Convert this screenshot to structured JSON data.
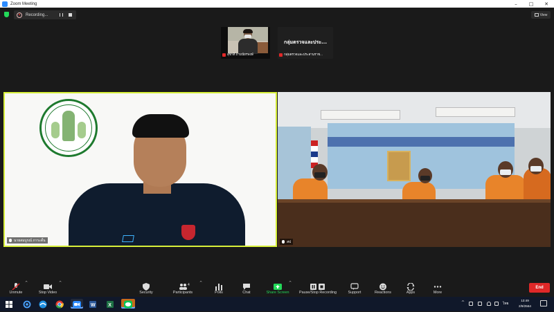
{
  "window": {
    "title": "Zoom Meeting",
    "controls": [
      "–",
      "□",
      "✕"
    ]
  },
  "recording": {
    "label": "Recording..."
  },
  "view_button": {
    "label": "View"
  },
  "thumbnails": [
    {
      "name": "สุชาติ ถามนัยรพงษ์",
      "type": "video",
      "mic_muted": true
    },
    {
      "name": "กลุ่มตรวจและประสานราช...",
      "display_name": "กลุ่มตรวจและประ...",
      "type": "name",
      "mic_muted": true
    }
  ],
  "tiles": [
    {
      "name": "นายสมบูรณ์ ภาระดั้น",
      "side": "left",
      "active_speaker": true
    },
    {
      "name": "สป",
      "side": "right",
      "active_speaker": false
    }
  ],
  "toolbar": {
    "unmute": "Unmute",
    "stop_video": "Stop Video",
    "security": "Security",
    "participants": "Participants",
    "participants_count": "4",
    "polls": "Polls",
    "chat": "Chat",
    "share_screen": "Share Screen",
    "pause_stop_recording": "Pause/Stop Recording",
    "support": "Support",
    "reactions": "Reactions",
    "apps": "Apps",
    "more": "More",
    "end": "End"
  },
  "taskbar": {
    "time": "13:49",
    "date": "2/9/2564",
    "language": "ไทย",
    "apps": [
      "start",
      "search",
      "edge",
      "chrome",
      "zoom",
      "word",
      "excel",
      "line"
    ]
  },
  "colors": {
    "accent_green": "#23d959",
    "end_red": "#e02828",
    "active_speaker_border": "#d8f03a",
    "zoom_blue": "#2d8cff"
  }
}
